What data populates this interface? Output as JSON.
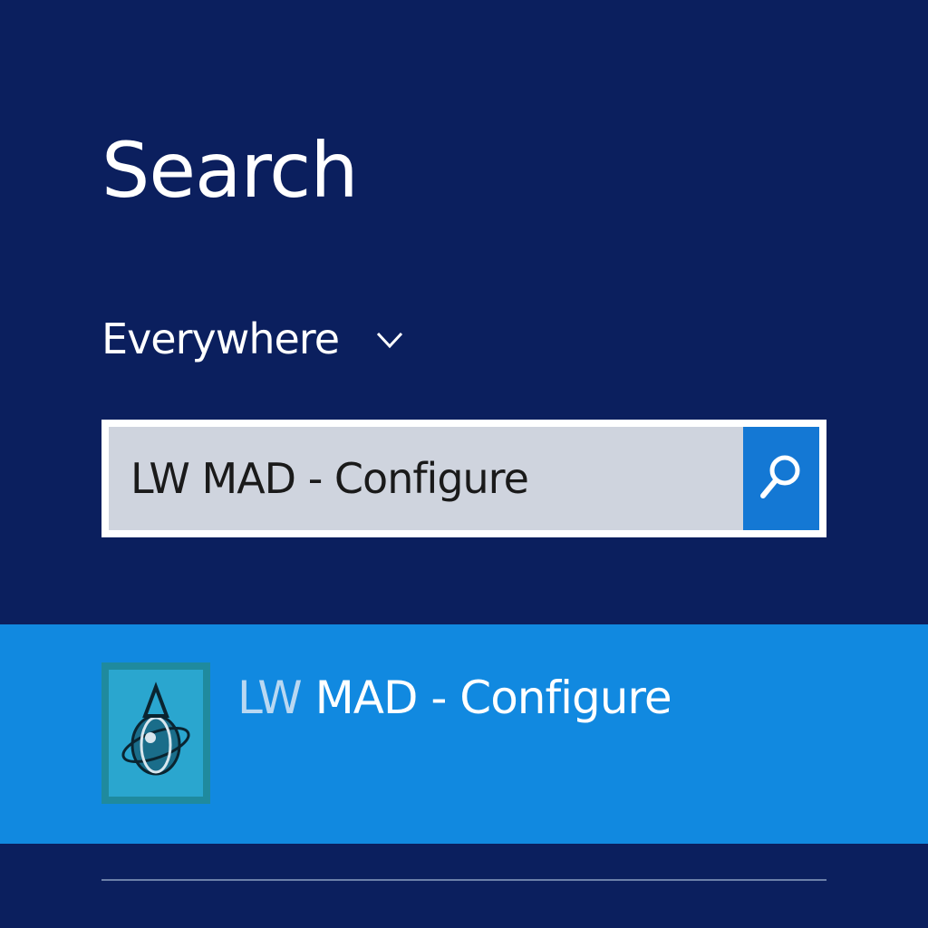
{
  "search_pane": {
    "title": "Search",
    "scope": {
      "label": "Everywhere",
      "icon": "chevron-down-icon"
    },
    "search_box": {
      "value": "LW MAD - Configure",
      "button_icon": "search-icon"
    },
    "results": [
      {
        "label_match": "LW",
        "label_rest": " MAD - Configure",
        "icon": "app-logo-icon"
      }
    ]
  },
  "colors": {
    "background": "#0b1f5e",
    "selected_row": "#1189e0",
    "search_button": "#1478d4",
    "input_background": "#cfd4de",
    "match_text": "#b9d8f2"
  }
}
